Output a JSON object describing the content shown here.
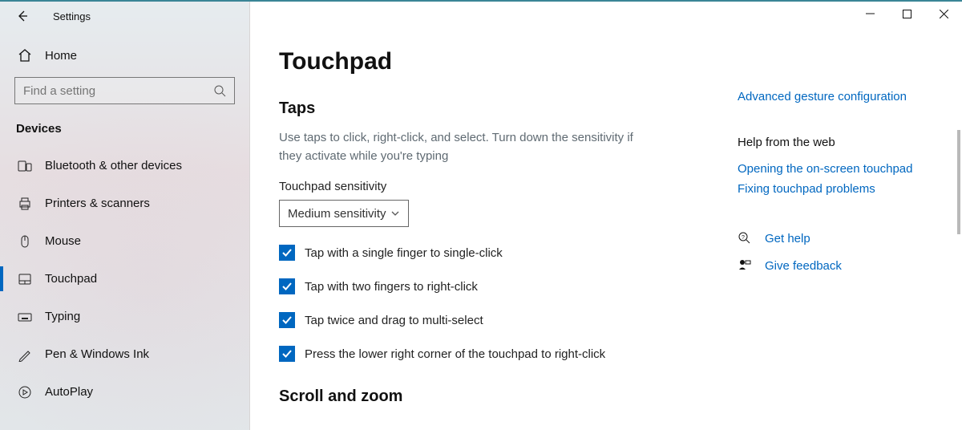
{
  "window": {
    "title": "Settings"
  },
  "win_controls": {
    "minimize": "—",
    "maximize": "☐",
    "close": "✕"
  },
  "home_label": "Home",
  "search": {
    "placeholder": "Find a setting"
  },
  "section": "Devices",
  "nav": [
    {
      "label": "Bluetooth & other devices"
    },
    {
      "label": "Printers & scanners"
    },
    {
      "label": "Mouse"
    },
    {
      "label": "Touchpad"
    },
    {
      "label": "Typing"
    },
    {
      "label": "Pen & Windows Ink"
    },
    {
      "label": "AutoPlay"
    }
  ],
  "page": {
    "title": "Touchpad",
    "section1": "Taps",
    "desc": "Use taps to click, right-click, and select. Turn down the sensitivity if they activate while you're typing",
    "sensitivity_label": "Touchpad sensitivity",
    "sensitivity_value": "Medium sensitivity",
    "checks": [
      "Tap with a single finger to single-click",
      "Tap with two fingers to right-click",
      "Tap twice and drag to multi-select",
      "Press the lower right corner of the touchpad to right-click"
    ],
    "section2": "Scroll and zoom"
  },
  "side": {
    "adv_link": "Advanced gesture configuration",
    "help_head": "Help from the web",
    "help_links": [
      "Opening the on-screen touchpad",
      "Fixing touchpad problems"
    ],
    "get_help": "Get help",
    "feedback": "Give feedback"
  }
}
